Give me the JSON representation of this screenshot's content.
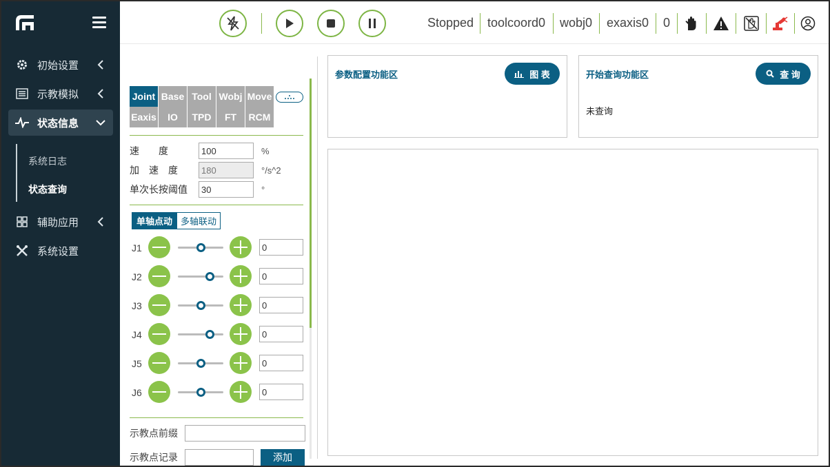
{
  "sidebar": {
    "items": [
      {
        "label": "初始设置",
        "icon": "gear-icon"
      },
      {
        "label": "示教模拟",
        "icon": "list-icon"
      },
      {
        "label": "状态信息",
        "icon": "pulse-icon"
      },
      {
        "label": "辅助应用",
        "icon": "grid-icon"
      },
      {
        "label": "系统设置",
        "icon": "tools-icon"
      }
    ],
    "subitems": [
      {
        "label": "系统日志"
      },
      {
        "label": "状态查询"
      }
    ]
  },
  "topbar": {
    "status": "Stopped",
    "tool": "toolcoord0",
    "wobj": "wobj0",
    "exaxis": "exaxis0",
    "count": "0"
  },
  "panel": {
    "tabs_row1": [
      "Joint",
      "Base",
      "Tool",
      "Wobj",
      "Move"
    ],
    "tabs_row2": [
      "Eaxis",
      "IO",
      "TPD",
      "FT",
      "RCM"
    ],
    "params": [
      {
        "label": "速　　度",
        "value": "100",
        "unit": "%"
      },
      {
        "label": "加　速　度",
        "value": "180",
        "unit": "°/s^2"
      },
      {
        "label": "单次长按阈值",
        "value": "30",
        "unit": "°"
      }
    ],
    "mode_single": "单轴点动",
    "mode_multi": "多轴联动",
    "joints": [
      {
        "name": "J1",
        "value": "0",
        "level": 0.5
      },
      {
        "name": "J2",
        "value": "0",
        "level": 0.7
      },
      {
        "name": "J3",
        "value": "0",
        "level": 0.5
      },
      {
        "name": "J4",
        "value": "0",
        "level": 0.7
      },
      {
        "name": "J5",
        "value": "0",
        "level": 0.5
      },
      {
        "name": "J6",
        "value": "0",
        "level": 0.5
      }
    ],
    "prefix_label": "示教点前缀",
    "record_label": "示教点记录",
    "add_label": "添加"
  },
  "cards": {
    "config_title": "参数配置功能区",
    "chart_btn": "图 表",
    "query_title": "开始查询功能区",
    "query_btn": "查 询",
    "query_status": "未查询"
  },
  "colors": {
    "sidebar_bg": "#172a35",
    "accent": "#0b5f83",
    "green": "#8bc34a"
  }
}
